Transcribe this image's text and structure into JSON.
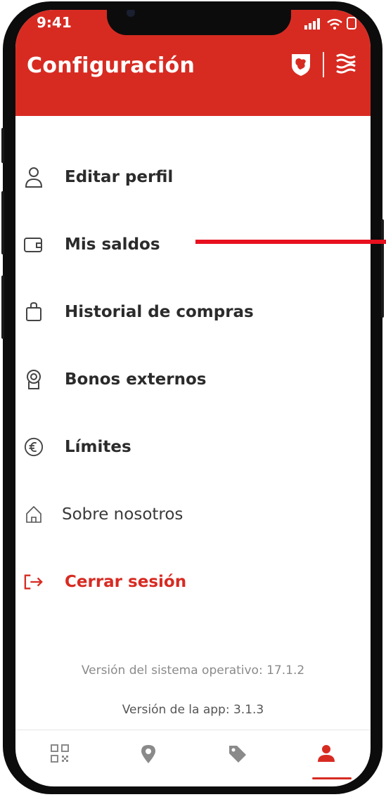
{
  "status_bar": {
    "time": "9:41"
  },
  "header": {
    "title": "Configuración",
    "crest_icon": "crest-icon",
    "menu_icon": "waves-icon"
  },
  "menu": {
    "items": [
      {
        "label": "Editar perfil",
        "icon": "user-icon"
      },
      {
        "label": "Mis saldos",
        "icon": "wallet-icon"
      },
      {
        "label": "Historial de compras",
        "icon": "shopping-bag-icon"
      },
      {
        "label": "Bonos externos",
        "icon": "badge-icon"
      },
      {
        "label": "Límites",
        "icon": "euro-icon"
      },
      {
        "label": "Sobre nosotros",
        "icon": "home-icon"
      },
      {
        "label": "Cerrar sesión",
        "icon": "logout-icon"
      }
    ]
  },
  "footer": {
    "os_version": "Versión del sistema operativo: 17.1.2",
    "app_version": "Versión de la app: 3.1.3"
  },
  "tabbar": {
    "tabs": [
      {
        "icon": "qr-code-icon",
        "active": false
      },
      {
        "icon": "location-pin-icon",
        "active": false
      },
      {
        "icon": "tag-icon",
        "active": false
      },
      {
        "icon": "profile-icon",
        "active": true
      }
    ]
  },
  "colors": {
    "brand": "#d72b22",
    "annotation_line": "#e8101e"
  }
}
